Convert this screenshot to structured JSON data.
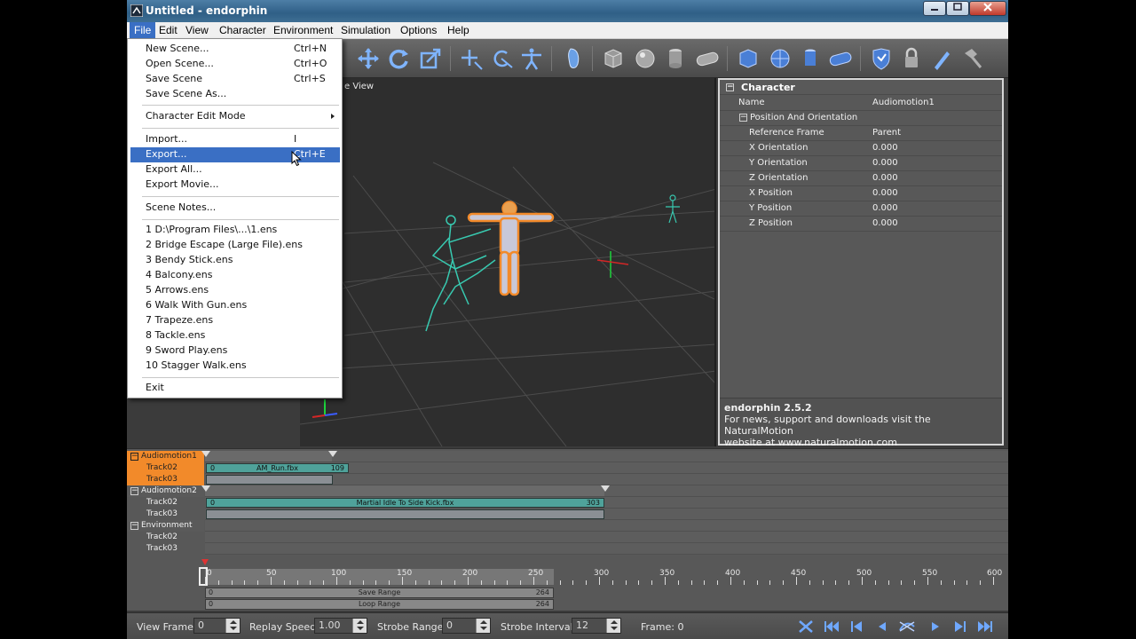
{
  "window": {
    "title": "Untitled - endorphin",
    "controls": [
      "minimize",
      "maximize",
      "close"
    ]
  },
  "menubar": {
    "items": [
      "File",
      "Edit",
      "View",
      "Character",
      "Environment",
      "Simulation",
      "Options",
      "Help"
    ],
    "active": "File"
  },
  "file_menu": {
    "items": [
      {
        "label": "New Scene...",
        "shortcut": "Ctrl+N"
      },
      {
        "label": "Open Scene...",
        "shortcut": "Ctrl+O"
      },
      {
        "label": "Save Scene",
        "shortcut": "Ctrl+S"
      },
      {
        "label": "Save Scene As...",
        "shortcut": ""
      },
      {
        "label": "Character Edit Mode",
        "shortcut": "",
        "submenu": true
      },
      {
        "label": "Import...",
        "shortcut": "I"
      },
      {
        "label": "Export...",
        "shortcut": "Ctrl+E",
        "selected": true
      },
      {
        "label": "Export All...",
        "shortcut": ""
      },
      {
        "label": "Export Movie...",
        "shortcut": ""
      },
      {
        "label": "Scene Notes...",
        "shortcut": ""
      },
      {
        "label": "1 D:\\Program Files\\...\\1.ens",
        "shortcut": ""
      },
      {
        "label": "2 Bridge Escape (Large File).ens",
        "shortcut": ""
      },
      {
        "label": "3 Bendy Stick.ens",
        "shortcut": ""
      },
      {
        "label": "4 Balcony.ens",
        "shortcut": ""
      },
      {
        "label": "5 Arrows.ens",
        "shortcut": ""
      },
      {
        "label": "6 Walk With Gun.ens",
        "shortcut": ""
      },
      {
        "label": "7 Trapeze.ens",
        "shortcut": ""
      },
      {
        "label": "8 Tackle.ens",
        "shortcut": ""
      },
      {
        "label": "9 Sword Play.ens",
        "shortcut": ""
      },
      {
        "label": "10 Stagger Walk.ens",
        "shortcut": ""
      },
      {
        "label": "Exit",
        "shortcut": ""
      }
    ]
  },
  "viewport": {
    "label": "e View"
  },
  "properties": {
    "header": "Character",
    "name_key": "Name",
    "name_value": "Audiomotion1",
    "group": "Position And Orientation",
    "rows": [
      {
        "key": "Reference Frame",
        "value": "Parent"
      },
      {
        "key": "X Orientation",
        "value": "0.000"
      },
      {
        "key": "Y Orientation",
        "value": "0.000"
      },
      {
        "key": "Z Orientation",
        "value": "0.000"
      },
      {
        "key": "X Position",
        "value": "0.000"
      },
      {
        "key": "Y Position",
        "value": "0.000"
      },
      {
        "key": "Z Position",
        "value": "0.000"
      }
    ],
    "footer_title": "endorphin 2.5.2",
    "footer_line1": "For news, support and downloads visit the NaturalMotion",
    "footer_line2": "website at www.naturalmotion.com"
  },
  "timeline": {
    "groups": [
      {
        "name": "Audiomotion1",
        "highlight": true,
        "tracks": [
          "Track02",
          "Track03"
        ]
      },
      {
        "name": "Audiomotion2",
        "highlight": false,
        "tracks": [
          "Track02",
          "Track03"
        ]
      },
      {
        "name": "Environment",
        "highlight": false,
        "tracks": [
          "Track02",
          "Track03"
        ]
      }
    ],
    "clips": [
      {
        "name": "AM_Run.fbx",
        "start": "0",
        "end": "109"
      },
      {
        "name": "Martial Idle To Side Kick.fbx",
        "start": "0",
        "end": "303"
      }
    ],
    "ruler_ticks": [
      "0",
      "50",
      "100",
      "150",
      "200",
      "250",
      "300",
      "350",
      "400",
      "450",
      "500",
      "550",
      "600"
    ],
    "save_range": {
      "label": "Save Range",
      "start": "0",
      "end": "264"
    },
    "loop_range": {
      "label": "Loop Range",
      "start": "0",
      "end": "264"
    }
  },
  "statusbar": {
    "view_frame_label": "View Frame:",
    "view_frame_value": "0",
    "replay_speed_label": "Replay Speed:",
    "replay_speed_value": "1.00",
    "strobe_range_label": "Strobe Range:",
    "strobe_range_value": "0",
    "strobe_interval_label": "Strobe Interval:",
    "strobe_interval_value": "12",
    "frame_label": "Frame: 0"
  },
  "colors": {
    "menu_highlight": "#3a6fc4",
    "clip_teal": "#4fa29a",
    "character_orange": "#f28a2a",
    "track_header_orange": "#f28a2a",
    "skeleton_cyan": "#38c9b0"
  }
}
